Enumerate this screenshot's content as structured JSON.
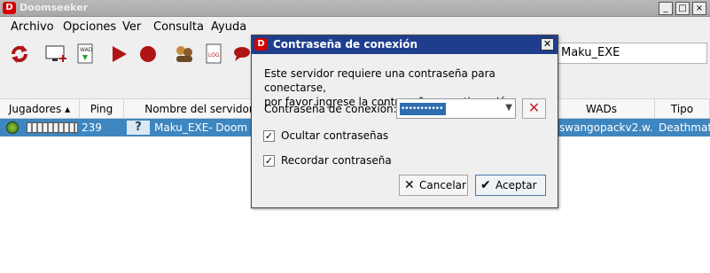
{
  "window": {
    "title": "Doomseeker",
    "controls": [
      "_",
      "□",
      "×"
    ]
  },
  "menubar": {
    "items": [
      {
        "label": "Archivo"
      },
      {
        "label": "Opciones"
      },
      {
        "label": "Ver"
      },
      {
        "label": "Consulta"
      },
      {
        "label": "Ayuda"
      }
    ]
  },
  "toolbar": {
    "icons": [
      "refresh-icon",
      "screen-add-icon",
      "wad-icon",
      "play-icon",
      "record-icon",
      "players-icon",
      "log-icon",
      "chat-icon"
    ],
    "search_value": "Maku_EXE"
  },
  "table": {
    "columns": [
      "Jugadores",
      "Ping",
      "Nombre del servidor",
      "WADs",
      "Tipo"
    ],
    "rows": [
      {
        "ping": "239",
        "name": "Maku_EXE- Doom",
        "wads": "swangopackv2.w...",
        "type": "Deathmat"
      }
    ]
  },
  "dialog": {
    "title": "Contraseña de conexión",
    "message_line1": "Este servidor requiere una contraseña para conectarse,",
    "message_line2": "por favor ingrese la contraseña a continuación.",
    "password_label": "Contraseña de conexión:",
    "password_masked": "•••••••••••",
    "hide_passwords_label": "Ocultar contraseñas",
    "remember_password_label": "Recordar contraseña",
    "hide_passwords_checked": true,
    "remember_password_checked": true,
    "cancel_label": "Cancelar",
    "accept_label": "Aceptar"
  }
}
